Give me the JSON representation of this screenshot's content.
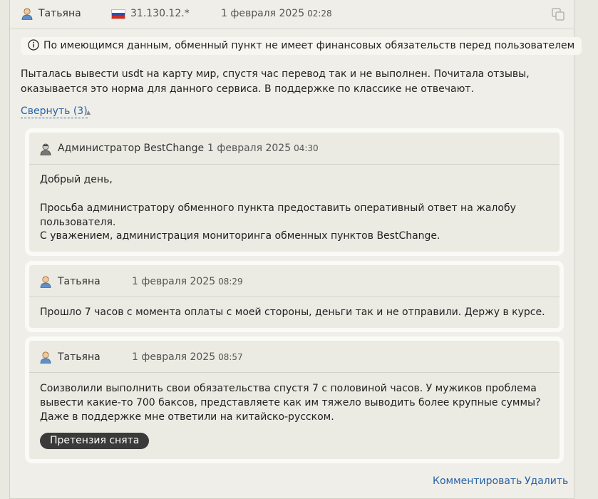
{
  "header": {
    "author": "Татьяна",
    "ip": "31.130.12.*",
    "date": "1 февраля 2025",
    "time": "02:28"
  },
  "notice": "По имеющимся данным, обменный пункт не имеет финансовых обязательств перед пользователем",
  "review_text": "Пыталась вывести usdt на карту мир, спустя час перевод так и не выполнен. Почитала отзывы, оказывается это норма для данного сервиса. В поддержке по классике не отвечают.",
  "collapse_link": "Свернуть (3)",
  "replies": [
    {
      "author": "Администратор BestChange",
      "date": "1 февраля 2025",
      "time": "04:30",
      "lines": [
        "Добрый день,",
        "Просьба администратору обменного пункта предоставить оперативный ответ на жалобу пользователя.",
        "С уважением, администрация мониторинга обменных пунктов BestChange."
      ]
    },
    {
      "author": "Татьяна",
      "date": "1 февраля 2025",
      "time": "08:29",
      "lines": [
        "Прошло 7 часов с момента оплаты с моей стороны, деньги так и не отправили. Держу в курсе."
      ]
    },
    {
      "author": "Татьяна",
      "date": "1 февраля 2025",
      "time": "08:57",
      "lines": [
        "Соизволили выполнить свои обязательства спустя 7 с половиной часов. У мужиков проблема вывести какие-то 700 баксов, представляете как им тяжело выводить более крупные суммы? Даже в поддержке мне ответили на китайско-русском."
      ],
      "badge": "Претензия снята"
    }
  ],
  "footer": {
    "comment": "Комментировать",
    "delete": "Удалить"
  },
  "colors": {
    "link": "#2563a8",
    "badge_bg": "#3a3a3a"
  }
}
